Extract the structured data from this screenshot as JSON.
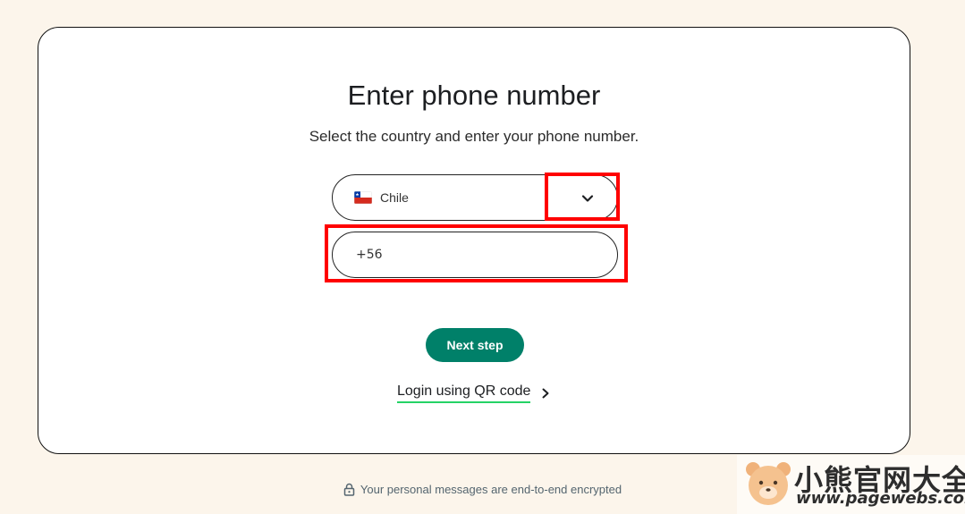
{
  "page": {
    "title": "Enter phone number",
    "subtitle": "Select the country and enter your phone number."
  },
  "country_select": {
    "flag_icon": "chile-flag-icon",
    "selected_value": "Chile",
    "dropdown_icon": "chevron-down-icon"
  },
  "phone_input": {
    "value": "+56"
  },
  "actions": {
    "next_label": "Next step",
    "qr_login_label": "Login using QR code",
    "qr_login_icon": "chevron-right-icon"
  },
  "footer": {
    "encryption_text": "Your personal messages are end-to-end encrypted",
    "icon": "lock-icon"
  },
  "watermark": {
    "title": "小熊官网大全",
    "url": "www.pagewebs.com"
  },
  "colors": {
    "background": "#fcf5eb",
    "accent": "#008069",
    "link_underline": "#25d366",
    "highlight": "#ff0000"
  }
}
